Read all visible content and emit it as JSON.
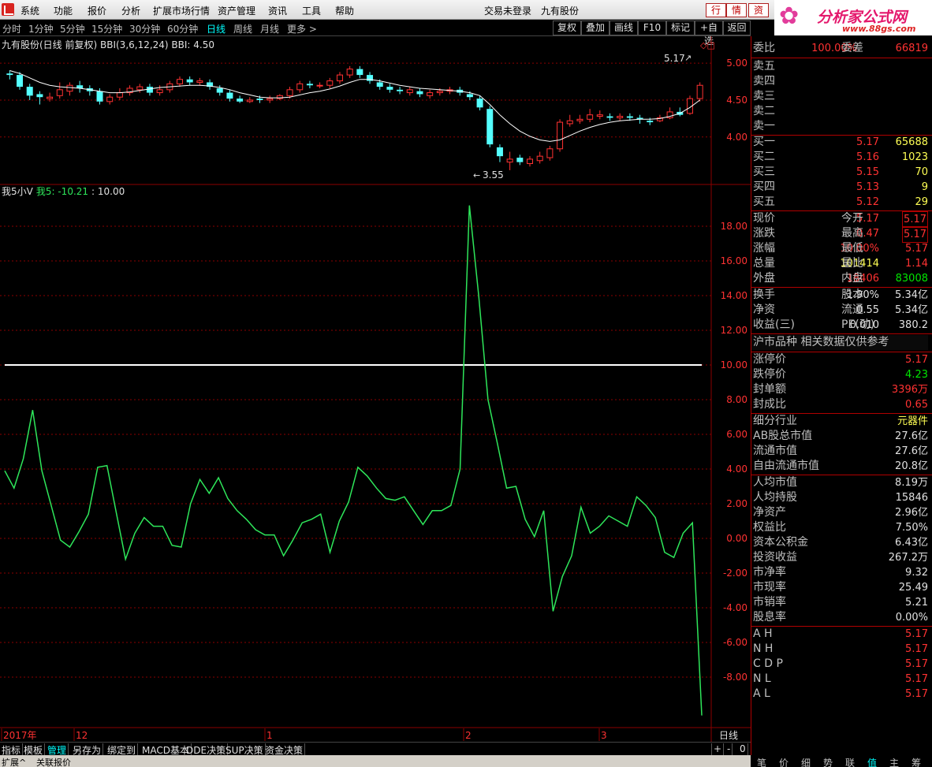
{
  "menu": [
    "系统",
    "功能",
    "报价",
    "分析",
    "扩展市场行情",
    "资产管理",
    "资讯",
    "工具",
    "帮助"
  ],
  "login_status": "交易未登录",
  "stock_title": "九有股份",
  "top_buttons": [
    "行",
    "情",
    "资"
  ],
  "brand": {
    "name": "分析家公式网",
    "url": "www.88gs.com",
    "flower": "✿"
  },
  "periods": [
    "分时",
    "1分钟",
    "5分钟",
    "15分钟",
    "30分钟",
    "60分钟",
    "日线",
    "周线",
    "月线",
    "更多 >"
  ],
  "active_period": "日线",
  "toolbar_buttons": [
    "复权",
    "叠加",
    "画线",
    "F10",
    "标记",
    "+自选",
    "返回"
  ],
  "main_chart": {
    "header": "九有股份(日线 前复权) BBI(3,6,12,24) BBI: 4.50",
    "last_price_label": "5.17",
    "low_label": "3.55",
    "ticks": [
      "5.00",
      "4.50",
      "4.00"
    ]
  },
  "indicator": {
    "header_name": "我5小V",
    "header_series": "我5: -10.21",
    "header_level": ": 10.00",
    "ticks": [
      "18.00",
      "16.00",
      "14.00",
      "12.00",
      "10.00",
      "8.00",
      "6.00",
      "4.00",
      "2.00",
      "0.00",
      "-2.00",
      "-4.00",
      "-6.00",
      "-8.00"
    ]
  },
  "time_axis": {
    "labels": [
      "2017年",
      "12",
      "1",
      "2",
      "3"
    ],
    "right_label": "日线"
  },
  "chart_data": [
    {
      "type": "candlestick",
      "ylim": [
        3.4,
        5.3
      ],
      "ticks": [
        5.0,
        4.5,
        4.0
      ],
      "candles": [
        [
          4.86,
          4.84,
          4.9,
          4.78
        ],
        [
          4.84,
          4.68,
          4.88,
          4.64
        ],
        [
          4.68,
          4.56,
          4.72,
          4.5
        ],
        [
          4.58,
          4.54,
          4.62,
          4.44
        ],
        [
          4.52,
          4.54,
          4.6,
          4.48
        ],
        [
          4.56,
          4.64,
          4.74,
          4.52
        ],
        [
          4.62,
          4.7,
          4.74,
          4.56
        ],
        [
          4.7,
          4.66,
          4.76,
          4.6
        ],
        [
          4.66,
          4.62,
          4.7,
          4.56
        ],
        [
          4.62,
          4.48,
          4.66,
          4.44
        ],
        [
          4.48,
          4.54,
          4.58,
          4.44
        ],
        [
          4.54,
          4.6,
          4.66,
          4.5
        ],
        [
          4.6,
          4.66,
          4.7,
          4.56
        ],
        [
          4.64,
          4.68,
          4.72,
          4.6
        ],
        [
          4.68,
          4.6,
          4.72,
          4.56
        ],
        [
          4.6,
          4.64,
          4.7,
          4.56
        ],
        [
          4.64,
          4.72,
          4.76,
          4.6
        ],
        [
          4.72,
          4.78,
          4.82,
          4.68
        ],
        [
          4.78,
          4.74,
          4.82,
          4.7
        ],
        [
          4.74,
          4.76,
          4.8,
          4.7
        ],
        [
          4.74,
          4.68,
          4.78,
          4.64
        ],
        [
          4.66,
          4.6,
          4.7,
          4.56
        ],
        [
          4.6,
          4.52,
          4.64,
          4.48
        ],
        [
          4.52,
          4.48,
          4.56,
          4.46
        ],
        [
          4.48,
          4.5,
          4.54,
          4.46
        ],
        [
          4.52,
          4.5,
          4.56,
          4.46
        ],
        [
          4.5,
          4.52,
          4.56,
          4.46
        ],
        [
          4.52,
          4.56,
          4.58,
          4.5
        ],
        [
          4.56,
          4.64,
          4.68,
          4.52
        ],
        [
          4.64,
          4.72,
          4.76,
          4.6
        ],
        [
          4.72,
          4.7,
          4.76,
          4.66
        ],
        [
          4.7,
          4.7,
          4.74,
          4.66
        ],
        [
          4.7,
          4.76,
          4.8,
          4.66
        ],
        [
          4.76,
          4.84,
          4.88,
          4.72
        ],
        [
          4.84,
          4.92,
          4.96,
          4.8
        ],
        [
          4.92,
          4.84,
          4.96,
          4.8
        ],
        [
          4.84,
          4.76,
          4.88,
          4.72
        ],
        [
          4.74,
          4.68,
          4.78,
          4.64
        ],
        [
          4.68,
          4.64,
          4.72,
          4.6
        ],
        [
          4.64,
          4.62,
          4.68,
          4.58
        ],
        [
          4.6,
          4.64,
          4.68,
          4.56
        ],
        [
          4.62,
          4.58,
          4.66,
          4.54
        ],
        [
          4.56,
          4.6,
          4.64,
          4.52
        ],
        [
          4.6,
          4.62,
          4.66,
          4.56
        ],
        [
          4.62,
          4.64,
          4.68,
          4.58
        ],
        [
          4.64,
          4.6,
          4.68,
          4.56
        ],
        [
          4.58,
          4.54,
          4.62,
          4.5
        ],
        [
          4.52,
          4.4,
          4.56,
          4.36
        ],
        [
          4.38,
          3.9,
          4.42,
          3.86
        ],
        [
          3.86,
          3.74,
          3.9,
          3.66
        ],
        [
          3.66,
          3.7,
          3.8,
          3.55
        ],
        [
          3.72,
          3.66,
          3.76,
          3.62
        ],
        [
          3.64,
          3.7,
          3.74,
          3.6
        ],
        [
          3.68,
          3.74,
          3.8,
          3.64
        ],
        [
          3.72,
          3.84,
          3.88,
          3.68
        ],
        [
          3.84,
          4.2,
          4.24,
          3.8
        ],
        [
          4.18,
          4.22,
          4.3,
          4.14
        ],
        [
          4.22,
          4.24,
          4.3,
          4.18
        ],
        [
          4.24,
          4.3,
          4.38,
          4.2
        ],
        [
          4.28,
          4.3,
          4.36,
          4.24
        ],
        [
          4.28,
          4.26,
          4.32,
          4.22
        ],
        [
          4.26,
          4.28,
          4.32,
          4.22
        ],
        [
          4.28,
          4.26,
          4.32,
          4.22
        ],
        [
          4.26,
          4.24,
          4.3,
          4.18
        ],
        [
          4.22,
          4.2,
          4.26,
          4.16
        ],
        [
          4.22,
          4.26,
          4.3,
          4.2
        ],
        [
          4.26,
          4.34,
          4.4,
          4.24
        ],
        [
          4.34,
          4.3,
          4.4,
          4.28
        ],
        [
          4.32,
          4.52,
          4.56,
          4.3
        ],
        [
          4.52,
          4.7,
          4.74,
          4.48
        ]
      ],
      "bbi": [
        4.9,
        4.86,
        4.8,
        4.74,
        4.7,
        4.68,
        4.67,
        4.66,
        4.64,
        4.62,
        4.6,
        4.6,
        4.61,
        4.63,
        4.65,
        4.67,
        4.68,
        4.69,
        4.7,
        4.7,
        4.69,
        4.67,
        4.64,
        4.6,
        4.57,
        4.54,
        4.53,
        4.53,
        4.54,
        4.57,
        4.6,
        4.62,
        4.65,
        4.69,
        4.74,
        4.78,
        4.78,
        4.76,
        4.73,
        4.7,
        4.68,
        4.66,
        4.65,
        4.64,
        4.63,
        4.62,
        4.6,
        4.56,
        4.44,
        4.3,
        4.18,
        4.08,
        4.01,
        3.96,
        3.94,
        3.96,
        4.02,
        4.08,
        4.13,
        4.17,
        4.2,
        4.22,
        4.23,
        4.24,
        4.24,
        4.25,
        4.28,
        4.32,
        4.4,
        4.5
      ]
    },
    {
      "type": "line",
      "ylim": [
        -10.5,
        19.5
      ],
      "level": 10.0,
      "series": [
        {
          "name": "我5",
          "values": [
            3.9,
            2.9,
            4.6,
            7.4,
            3.9,
            1.9,
            -0.1,
            -0.5,
            0.4,
            1.4,
            4.1,
            4.2,
            1.5,
            -1.2,
            0.3,
            1.2,
            0.7,
            0.7,
            -0.4,
            -0.5,
            2.0,
            3.4,
            2.6,
            3.5,
            2.3,
            1.6,
            1.1,
            0.5,
            0.2,
            0.2,
            -1.0,
            -0.1,
            0.9,
            1.1,
            1.4,
            -0.8,
            1.0,
            2.1,
            4.1,
            3.6,
            2.9,
            2.3,
            2.2,
            2.4,
            1.6,
            0.8,
            1.6,
            1.6,
            1.9,
            4.0,
            19.2,
            14.0,
            8.0,
            5.5,
            2.9,
            3.0,
            1.1,
            0.1,
            1.6,
            -4.2,
            -2.2,
            -1.0,
            1.8,
            0.3,
            0.7,
            1.3,
            1.0,
            0.7,
            2.4,
            1.9,
            1.2,
            -0.8,
            -1.1,
            0.3,
            0.9,
            -10.21
          ]
        }
      ]
    }
  ],
  "panel": {
    "wei_bi": {
      "label": "委比",
      "value": "100.00%",
      "label2": "委差",
      "value2": "66819"
    },
    "sells": [
      {
        "label": "卖五"
      },
      {
        "label": "卖四"
      },
      {
        "label": "卖三"
      },
      {
        "label": "卖二"
      },
      {
        "label": "卖一"
      }
    ],
    "buys": [
      {
        "label": "买一",
        "price": "5.17",
        "vol": "65688"
      },
      {
        "label": "买二",
        "price": "5.16",
        "vol": "1023"
      },
      {
        "label": "买三",
        "price": "5.15",
        "vol": "70"
      },
      {
        "label": "买四",
        "price": "5.13",
        "vol": "9"
      },
      {
        "label": "买五",
        "price": "5.12",
        "vol": "29"
      }
    ],
    "quote": [
      {
        "l1": "现价",
        "v1": "5.17",
        "l2": "今开",
        "v2": "5.17"
      },
      {
        "l1": "涨跌",
        "v1": "0.47",
        "l2": "最高",
        "v2": "5.17"
      },
      {
        "l1": "涨幅",
        "v1": "10.00%",
        "l2": "最低",
        "v2": "5.17"
      },
      {
        "l1": "总量",
        "v1": "101414",
        "l2": "量比",
        "v2": "1.14"
      },
      {
        "l1": "外盘",
        "v1": "18406",
        "l2": "内盘",
        "v2": "83008"
      }
    ],
    "fund": [
      {
        "l1": "换手",
        "v1": "1.90%",
        "l2": "股本",
        "v2": "5.34亿"
      },
      {
        "l1": "净资",
        "v1": "0.55",
        "l2": "流通",
        "v2": "5.34亿"
      },
      {
        "l1": "收益(三)",
        "v1": "0.010",
        "l2": "PE(动)",
        "v2": "380.2"
      }
    ],
    "notice": "沪市品种  相关数据仅供参考",
    "limits": [
      {
        "label": "涨停价",
        "value": "5.17"
      },
      {
        "label": "跌停价",
        "value": "4.23"
      },
      {
        "label": "封单额",
        "value": "3396万"
      },
      {
        "label": "封成比",
        "value": "0.65"
      }
    ],
    "industry": [
      {
        "label": "细分行业",
        "value": "元器件"
      },
      {
        "label": "AB股总市值",
        "value": "27.6亿"
      },
      {
        "label": "流通市值",
        "value": "27.6亿"
      },
      {
        "label": "自由流通市值",
        "value": "20.8亿"
      }
    ],
    "finance": [
      {
        "label": "人均市值",
        "value": "8.19万"
      },
      {
        "label": "人均持股",
        "value": "15846"
      },
      {
        "label": "净资产",
        "value": "2.96亿"
      },
      {
        "label": "权益比",
        "value": "7.50%"
      },
      {
        "label": "资本公积金",
        "value": "6.43亿"
      },
      {
        "label": "投资收益",
        "value": "267.2万"
      },
      {
        "label": "市净率",
        "value": "9.32"
      },
      {
        "label": "市现率",
        "value": "25.49"
      },
      {
        "label": "市销率",
        "value": "5.21"
      },
      {
        "label": "股息率",
        "value": "0.00%"
      }
    ],
    "indices": [
      {
        "label": "A H",
        "value": "5.17"
      },
      {
        "label": "N H",
        "value": "5.17"
      },
      {
        "label": "C D P",
        "value": "5.17"
      },
      {
        "label": "N L",
        "value": "5.17"
      },
      {
        "label": "A L",
        "value": "5.17"
      }
    ],
    "tabs": [
      "笔",
      "价",
      "细",
      "势",
      "联",
      "值",
      "主",
      "筹"
    ],
    "active_tab": "值"
  },
  "bottom_tabs": [
    "指标",
    "模板",
    "管理",
    "另存为",
    "绑定到",
    "MACD基本",
    "DDE决策",
    "SUP决策",
    "资金决策"
  ],
  "active_bottom_tab": "管理",
  "bottom_right": [
    "+",
    "-",
    "0"
  ],
  "status_tabs": [
    "扩展^",
    "关联报价"
  ],
  "colors": {
    "up": "#ff3232",
    "down": "#54ffff",
    "indicator": "#2ee65a",
    "bbi": "#ffffff",
    "grid": "#8b0000"
  }
}
